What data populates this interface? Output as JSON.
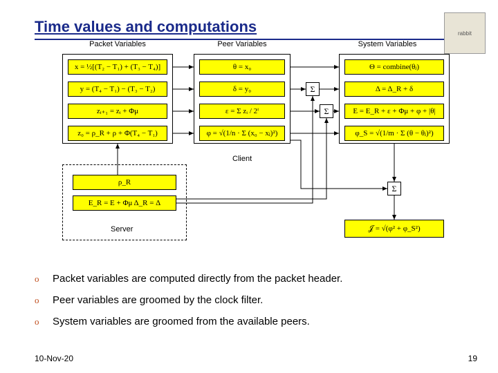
{
  "title": "Time values and computations",
  "logo_alt": "rabbit",
  "columns": {
    "packet": "Packet Variables",
    "peer": "Peer Variables",
    "system": "System Variables"
  },
  "packet": {
    "x": "x = ½[(T₂ − T₁) + (T₃ − T₄)]",
    "y": "y = (T₄ − T₁) − (T₃ − T₂)",
    "z": "zᵢ₊₁ = zᵢ + Φμ",
    "z0": "z₀ = ρ_R + ρ + Φ(T₄ − T₁)"
  },
  "peer": {
    "theta": "θ = x₀",
    "delta": "δ = y₀",
    "epsilon": "ε = Σ zᵢ / 2ⁱ",
    "phi": "φ = √(1/n · Σ (x₀ − xⱼ)²)"
  },
  "system": {
    "Theta": "Θ = combine(θⱼ)",
    "Delta": "Δ = Δ_R + δ",
    "E": "E = E_R + ε + Φμ + φ + |θ|",
    "phis": "φ_S = √(1/m · Σ (θ − θⱼ)²)",
    "final": "𝒥 = √(φ² + φ_S²)"
  },
  "server": {
    "rho": "ρ_R",
    "er": "E_R = E + Φμ    Δ_R = Δ"
  },
  "labels": {
    "client": "Client",
    "server": "Server"
  },
  "sigma": "Σ",
  "bullets": [
    "Packet variables are computed directly from the packet header.",
    "Peer variables are groomed by the clock filter.",
    "System variables are groomed from the available peers."
  ],
  "bullet_mark": "o",
  "footer": {
    "date": "10-Nov-20",
    "page": "19"
  }
}
